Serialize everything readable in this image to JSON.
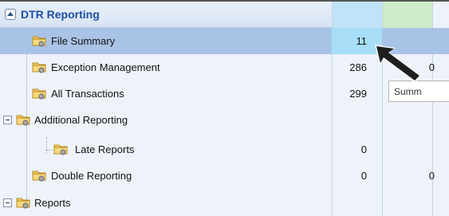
{
  "tree": {
    "title": "DTR Reporting",
    "rows": [
      {
        "label": "File Summary",
        "value1": "11",
        "value2": ""
      },
      {
        "label": "Exception Management",
        "value1": "286",
        "value2": "0"
      },
      {
        "label": "All Transactions",
        "value1": "299",
        "value2": ""
      },
      {
        "label": "Additional Reporting",
        "value1": "",
        "value2": ""
      },
      {
        "label": "Late Reports",
        "value1": "0",
        "value2": ""
      },
      {
        "label": "Double Reporting",
        "value1": "0",
        "value2": "0"
      },
      {
        "label": "Reports",
        "value1": "",
        "value2": ""
      }
    ]
  },
  "tooltip": {
    "text": "Summ"
  },
  "colors": {
    "title": "#1b4fa0",
    "selected_row": "#a9c3e6",
    "column1_header": "#bfe3f8",
    "column2_header": "#cdebc8",
    "panel": "#eef3fa"
  },
  "icons": {
    "folder": "folder-icon",
    "collapse": "collapse-icon",
    "expander": "minus-box-icon",
    "cursor": "mouse-cursor-icon"
  }
}
